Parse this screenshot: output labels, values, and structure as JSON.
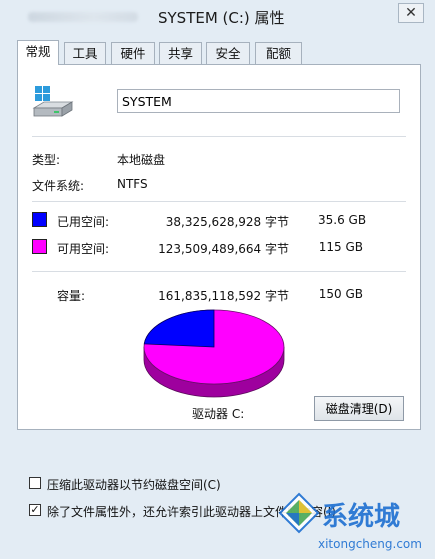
{
  "window": {
    "title": "SYSTEM (C:) 属性",
    "close_label": "✕"
  },
  "tabs": [
    {
      "label": "常规",
      "active": true
    },
    {
      "label": "工具"
    },
    {
      "label": "硬件"
    },
    {
      "label": "共享"
    },
    {
      "label": "安全"
    },
    {
      "label": "配额"
    }
  ],
  "general": {
    "drive_icon": "hard-drive-windows-icon",
    "volume_name": "SYSTEM",
    "type_label": "类型:",
    "type_value": "本地磁盘",
    "fs_label": "文件系统:",
    "fs_value": "NTFS",
    "used": {
      "label": "已用空间:",
      "bytes": "38,325,628,928 字节",
      "size": "35.6 GB",
      "color": "#0000ff"
    },
    "free": {
      "label": "可用空间:",
      "bytes": "123,509,489,664 字节",
      "size": "115 GB",
      "color": "#ff00ff"
    },
    "capacity": {
      "label": "容量:",
      "bytes": "161,835,118,592 字节",
      "size": "150 GB"
    },
    "drive_caption": "驱动器 C:",
    "cleanup_button": "磁盘清理(D)",
    "compress_option": {
      "label": "压缩此驱动器以节约磁盘空间(C)",
      "checked": false
    },
    "index_option": {
      "label": "除了文件属性外，还允许索引此驱动器上文件的内容(I)",
      "checked": true
    }
  },
  "chart_data": {
    "type": "pie",
    "categories": [
      "已用空间",
      "可用空间"
    ],
    "values": [
      35.6,
      115
    ],
    "colors": [
      "#0000ff",
      "#ff00ff"
    ]
  },
  "watermark": {
    "brand": "系统城",
    "url": "xitongcheng.com",
    "accent": "#1d6fd1"
  }
}
